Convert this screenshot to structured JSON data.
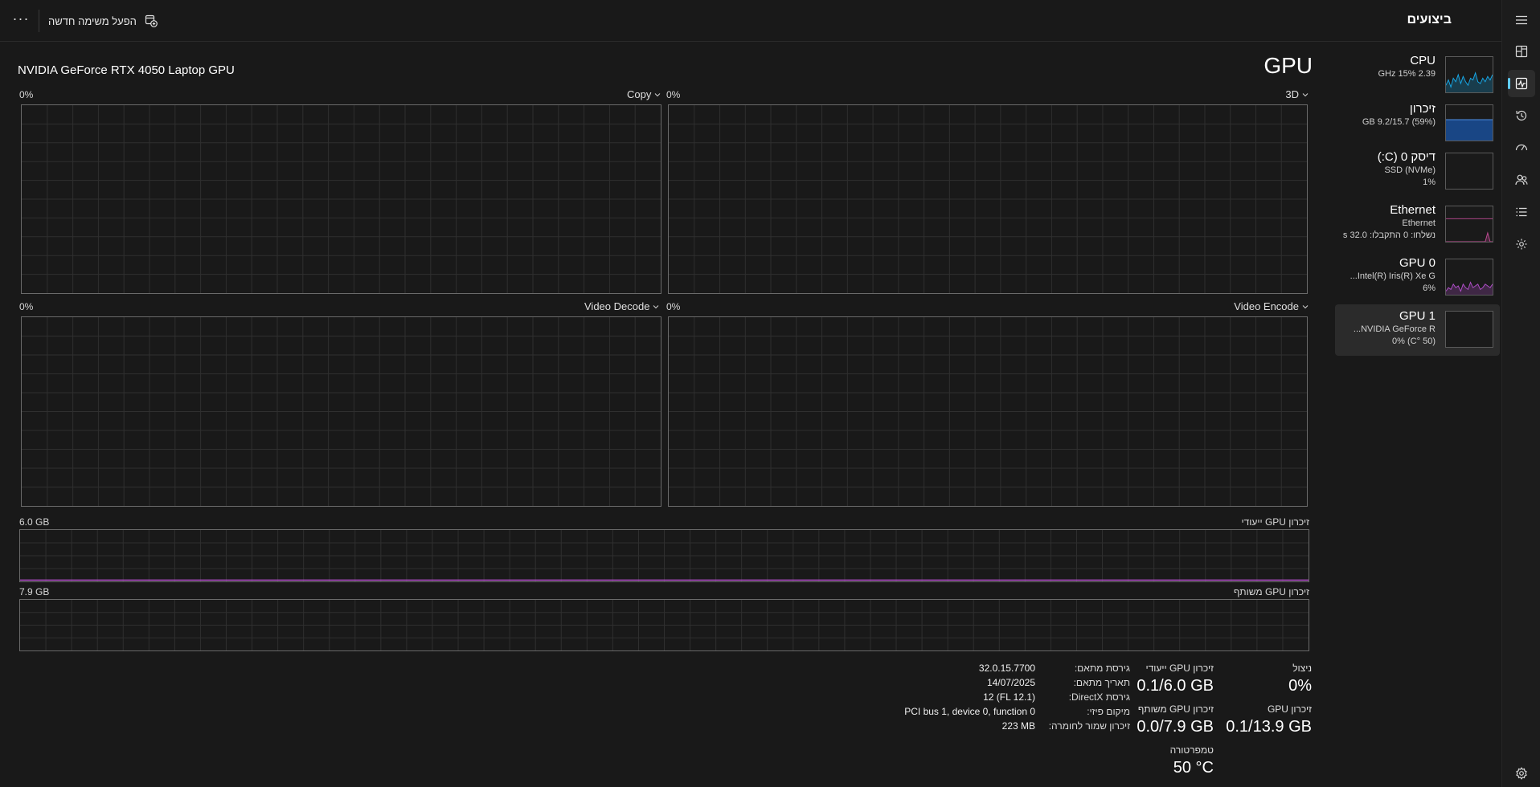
{
  "app": {
    "page_title": "ביצועים",
    "run_task_label": "הפעל משימה חדשה",
    "more_label": "···"
  },
  "nav": [
    {
      "name": "hamburger-menu",
      "icon": "menu-icon"
    },
    {
      "name": "processes",
      "icon": "processes-icon"
    },
    {
      "name": "performance",
      "icon": "performance-icon",
      "active": true
    },
    {
      "name": "app-history",
      "icon": "history-icon"
    },
    {
      "name": "startup-apps",
      "icon": "startup-icon"
    },
    {
      "name": "users",
      "icon": "users-icon"
    },
    {
      "name": "details",
      "icon": "details-icon"
    },
    {
      "name": "services",
      "icon": "services-icon"
    },
    {
      "name": "settings",
      "icon": "settings-icon"
    }
  ],
  "devices": [
    {
      "name": "CPU",
      "line1": "2.39 GHz  15%",
      "line2": "",
      "color": "#17a7e6",
      "spark": [
        0.2,
        0.35,
        0.15,
        0.4,
        0.3,
        0.5,
        0.25,
        0.45,
        0.3,
        0.2,
        0.4,
        0.35,
        0.55,
        0.3,
        0.25,
        0.4,
        0.3,
        0.45,
        0.35,
        0.5
      ]
    },
    {
      "name": "זיכרון",
      "line1": "(59%) 9.2/15.7 GB",
      "line2": "",
      "color": "#1a4f99",
      "fill": 0.59
    },
    {
      "name": "דיסק 0 (C:)",
      "line1": "SSD (NVMe)",
      "line2": "1%",
      "color": "#5a5a5a"
    },
    {
      "name": "Ethernet",
      "line1": "Ethernet",
      "line2": "נשלחו: 0 התקבלו: 32.0 s",
      "color": "#c04a94",
      "spark": [
        0,
        0,
        0,
        0,
        0,
        0,
        0,
        0,
        0,
        0,
        0,
        0,
        0,
        0,
        0,
        0,
        0,
        0.25,
        0,
        0
      ]
    },
    {
      "name": "GPU 0",
      "line1": "Intel(R) Iris(R) Xe G...",
      "line2": "6%",
      "color": "#b04ec8",
      "spark": [
        0.1,
        0.2,
        0.15,
        0.3,
        0.2,
        0.25,
        0.1,
        0.3,
        0.2,
        0.15,
        0.35,
        0.2,
        0.25,
        0.3,
        0.15,
        0.2,
        0.3,
        0.25,
        0.2,
        0.3
      ]
    },
    {
      "name": "GPU 1",
      "line1": "NVIDIA GeForce R...",
      "line2": "(50 °C)  0%",
      "color": "#b04ec8",
      "selected": true
    }
  ],
  "main": {
    "title": "GPU",
    "model": "NVIDIA GeForce RTX 4050 Laptop GPU",
    "engines": [
      {
        "label": "3D",
        "pct": "0%"
      },
      {
        "label": "Copy",
        "pct": "0%"
      },
      {
        "label": "Video Encode",
        "pct": "0%"
      },
      {
        "label": "Video Decode",
        "pct": "0%"
      }
    ],
    "dedicated_mem_graph_label": "זיכרון GPU ייעודי",
    "dedicated_mem_graph_max": "6.0 GB",
    "shared_mem_graph_label": "זיכרון GPU משותף",
    "shared_mem_graph_max": "7.9 GB"
  },
  "stats": {
    "utilization_label": "ניצול",
    "utilization_value": "0%",
    "gpu_memory_label": "זיכרון GPU",
    "gpu_memory_value": "0.1/13.9 GB",
    "dedicated_label": "זיכרון GPU ייעודי",
    "dedicated_value": "0.1/6.0 GB",
    "shared_label": "זיכרון GPU משותף",
    "shared_value": "0.0/7.9 GB",
    "temperature_label": "טמפרטורה",
    "temperature_value": "50 °C"
  },
  "info": [
    {
      "label": "גירסת מתאם:",
      "value": "32.0.15.7700"
    },
    {
      "label": "תאריך מתאם:",
      "value": "14/07/2025"
    },
    {
      "label": "גירסת DirectX:",
      "value": "12 (FL 12.1)"
    },
    {
      "label": "מיקום פיזי:",
      "value": "PCI bus 1, device 0, function 0"
    },
    {
      "label": "זיכרון שמור לחומרה:",
      "value": "223 MB"
    }
  ],
  "colors": {
    "gpu_accent": "#b04ec8",
    "nav_active": "#60cdff",
    "graph_border": "#6a6a6a",
    "grid": "#2f2f2f"
  }
}
